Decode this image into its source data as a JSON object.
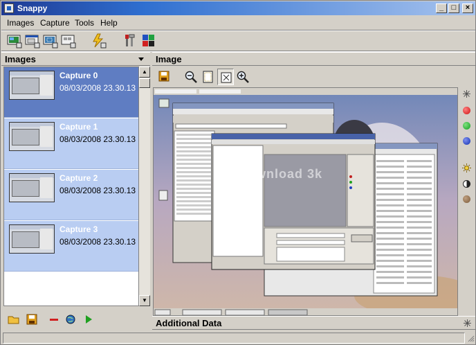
{
  "window": {
    "title": "Snappy"
  },
  "menu": [
    "Images",
    "Capture",
    "Tools",
    "Help"
  ],
  "toolbar_icons": [
    "capture-screen-icon",
    "capture-window-icon",
    "capture-region-icon",
    "capture-object-icon",
    "flash-capture-icon",
    "settings-tools-icon",
    "color-palette-icon"
  ],
  "left_panel": {
    "title": "Images",
    "captures": [
      {
        "name": "Capture 0",
        "date": "08/03/2008 23.30.13",
        "selected": true
      },
      {
        "name": "Capture 1",
        "date": "08/03/2008 23.30.13",
        "selected": false
      },
      {
        "name": "Capture 2",
        "date": "08/03/2008 23.30.13",
        "selected": false
      },
      {
        "name": "Capture 3",
        "date": "08/03/2008 23.30.13",
        "selected": false
      }
    ]
  },
  "image_panel": {
    "title": "Image",
    "tools": [
      "save-icon",
      "zoom-out-icon",
      "fit-page-icon",
      "actual-size-icon",
      "zoom-in-icon"
    ],
    "watermark": "download 3k"
  },
  "right_tools": [
    "pin-icon",
    "red-dot",
    "green-dot",
    "blue-dot",
    "brightness-icon",
    "contrast-icon",
    "brown-dot"
  ],
  "colors": {
    "red": "#cc1010",
    "green": "#10a020",
    "blue": "#1030b0",
    "brown": "#7a5a3a",
    "selected": "#5f7dc2",
    "item": "#b9cdf2"
  },
  "additional_data": {
    "title": "Additional Data"
  },
  "bottom_icons": [
    "open-folder-icon",
    "save-icon",
    "remove-icon",
    "globe-icon",
    "play-icon"
  ]
}
